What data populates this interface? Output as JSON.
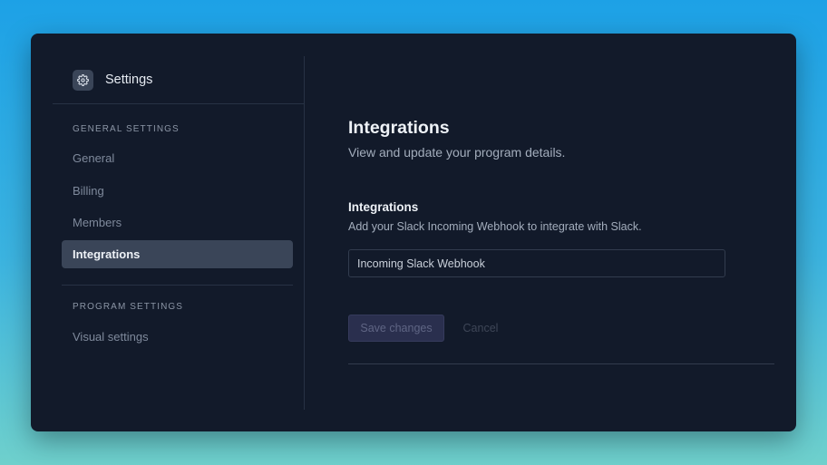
{
  "sidebar": {
    "brand": {
      "icon": "gear-icon",
      "title": "Settings"
    },
    "sections": [
      {
        "label": "GENERAL SETTINGS",
        "items": [
          {
            "label": "General",
            "active": false
          },
          {
            "label": "Billing",
            "active": false
          },
          {
            "label": "Members",
            "active": false
          },
          {
            "label": "Integrations",
            "active": true
          }
        ]
      },
      {
        "label": "PROGRAM SETTINGS",
        "items": [
          {
            "label": "Visual settings",
            "active": false
          }
        ]
      }
    ]
  },
  "main": {
    "title": "Integrations",
    "subtitle": "View and update your program details.",
    "integrations": {
      "title": "Integrations",
      "description": "Add your Slack Incoming Webhook to integrate with Slack.",
      "webhook_placeholder": "Incoming Slack Webhook",
      "webhook_value": ""
    },
    "actions": {
      "save_label": "Save changes",
      "cancel_label": "Cancel"
    }
  },
  "colors": {
    "window_bg": "#121a2a",
    "active_nav_bg": "#3a4558",
    "save_button_bg": "#2a2f4e"
  }
}
